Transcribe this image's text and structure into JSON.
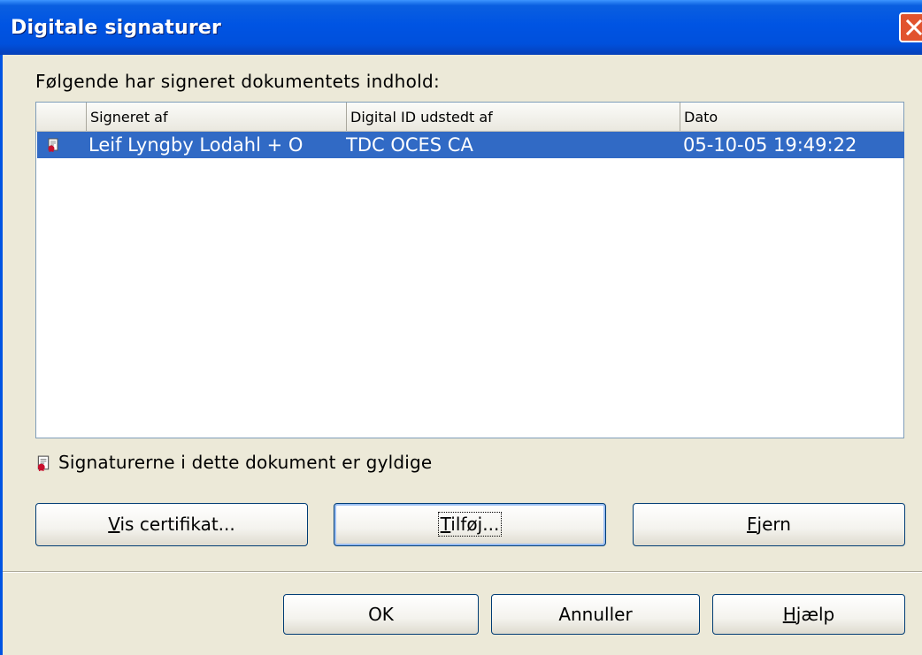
{
  "window": {
    "title": "Digitale signaturer"
  },
  "heading": "Følgende har signeret dokumentets indhold:",
  "table": {
    "columns": [
      "Signeret af",
      "Digital ID udstedt af",
      "Dato"
    ],
    "rows": [
      {
        "icon": "certificate-icon",
        "signer": "Leif Lyngby Lodahl + O",
        "issuer": "TDC OCES CA",
        "date": "05-10-05 19:49:22",
        "selected": true
      }
    ]
  },
  "status": {
    "icon": "certificate-icon",
    "text": "Signaturerne i dette dokument er gyldige"
  },
  "buttons": {
    "view_cert": {
      "mnemonic": "V",
      "rest": "is certifikat..."
    },
    "add": {
      "mnemonic": "T",
      "rest": "ilføj..."
    },
    "remove": {
      "mnemonic": "F",
      "rest": "jern"
    },
    "ok": "OK",
    "cancel": "Annuller",
    "help": {
      "mnemonic": "H",
      "rest": "jælp"
    }
  },
  "colors": {
    "titlebar": "#0054e3",
    "selection": "#316ac5",
    "close_button": "#e1532e",
    "dialog_bg": "#ece9d8"
  }
}
